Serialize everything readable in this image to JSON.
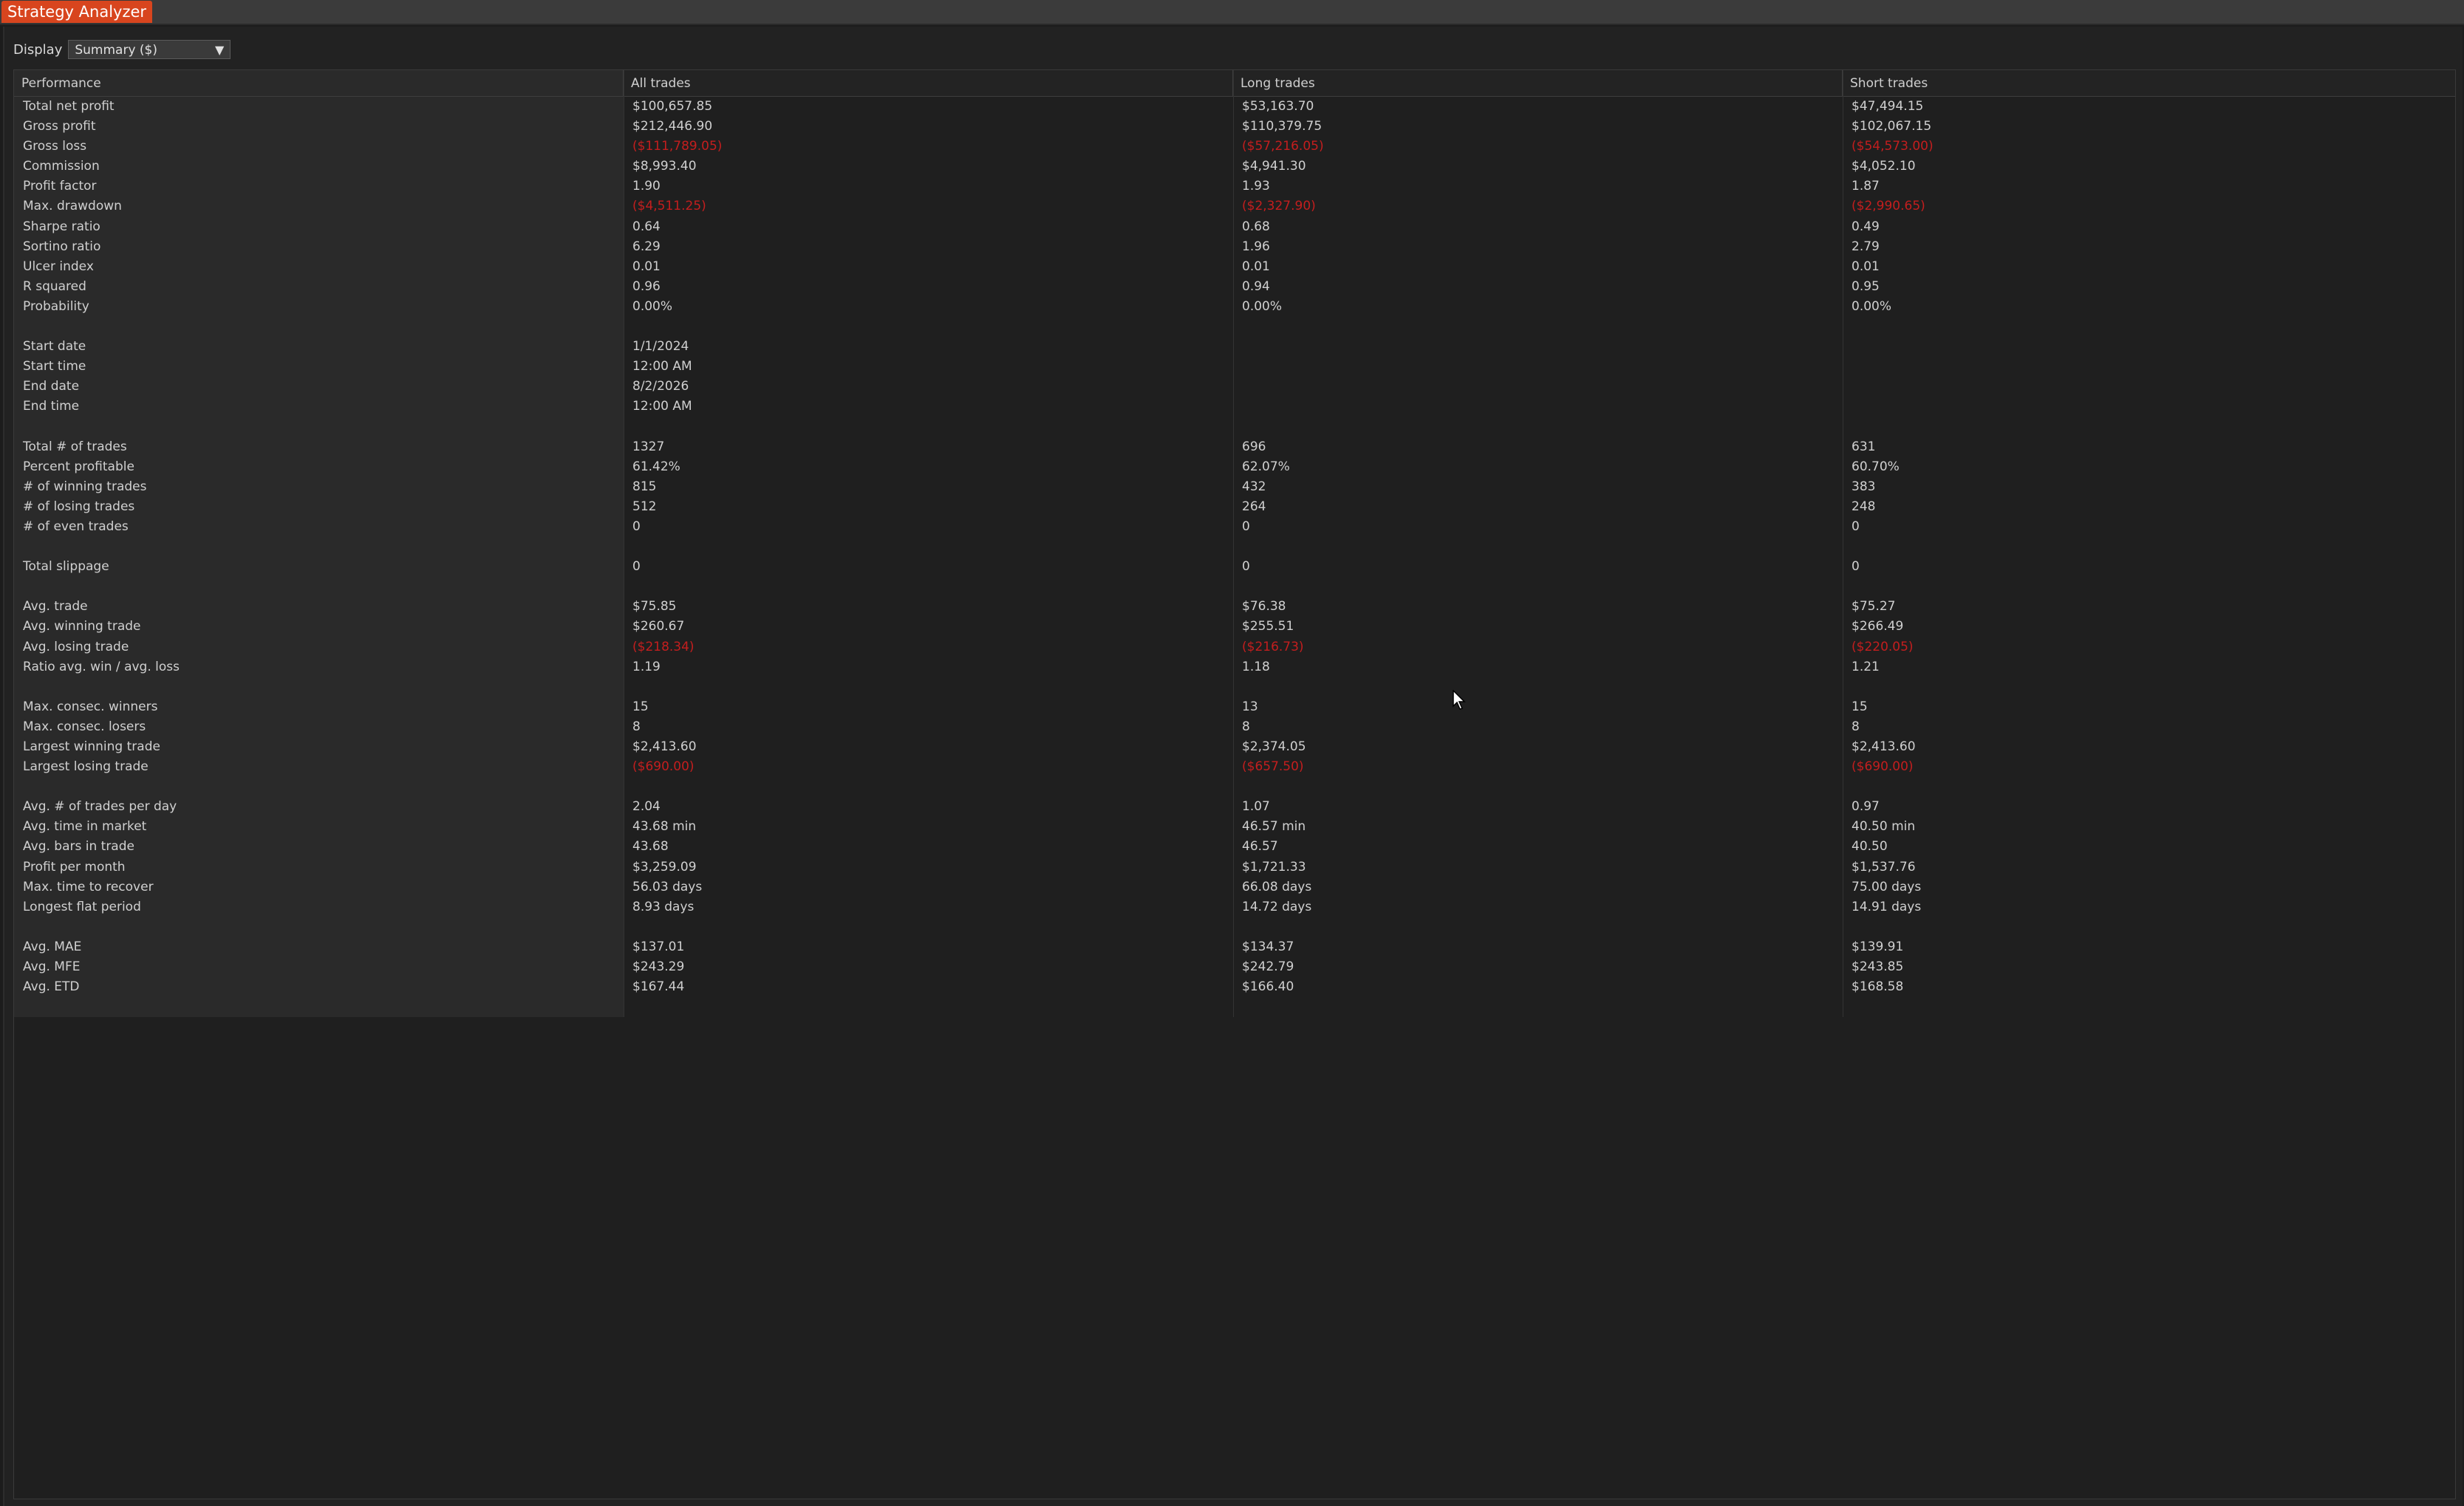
{
  "window": {
    "title": "Strategy Analyzer"
  },
  "display": {
    "label": "Display",
    "selected": "Summary ($)"
  },
  "columns": [
    "Performance",
    "All trades",
    "Long trades",
    "Short trades"
  ],
  "colors": {
    "accent": "#d8451e",
    "negative": "#c41e1e",
    "background": "#1c1c1c"
  },
  "rows": [
    {
      "label": "Total net profit",
      "all": "$100,657.85",
      "long": "$53,163.70",
      "short": "$47,494.15"
    },
    {
      "label": "Gross profit",
      "all": "$212,446.90",
      "long": "$110,379.75",
      "short": "$102,067.15"
    },
    {
      "label": "Gross loss",
      "all": "($111,789.05)",
      "long": "($57,216.05)",
      "short": "($54,573.00)",
      "neg": true
    },
    {
      "label": "Commission",
      "all": "$8,993.40",
      "long": "$4,941.30",
      "short": "$4,052.10"
    },
    {
      "label": "Profit factor",
      "all": "1.90",
      "long": "1.93",
      "short": "1.87"
    },
    {
      "label": "Max. drawdown",
      "all": "($4,511.25)",
      "long": "($2,327.90)",
      "short": "($2,990.65)",
      "neg": true
    },
    {
      "label": "Sharpe ratio",
      "all": "0.64",
      "long": "0.68",
      "short": "0.49"
    },
    {
      "label": "Sortino ratio",
      "all": "6.29",
      "long": "1.96",
      "short": "2.79"
    },
    {
      "label": "Ulcer index",
      "all": "0.01",
      "long": "0.01",
      "short": "0.01"
    },
    {
      "label": "R squared",
      "all": "0.96",
      "long": "0.94",
      "short": "0.95"
    },
    {
      "label": "Probability",
      "all": "0.00%",
      "long": "0.00%",
      "short": "0.00%"
    },
    {
      "label": "",
      "all": "",
      "long": "",
      "short": ""
    },
    {
      "label": "Start date",
      "all": "1/1/2024",
      "long": "",
      "short": ""
    },
    {
      "label": "Start time",
      "all": "12:00 AM",
      "long": "",
      "short": ""
    },
    {
      "label": "End date",
      "all": "8/2/2026",
      "long": "",
      "short": ""
    },
    {
      "label": "End time",
      "all": "12:00 AM",
      "long": "",
      "short": ""
    },
    {
      "label": "",
      "all": "",
      "long": "",
      "short": ""
    },
    {
      "label": "Total # of trades",
      "all": "1327",
      "long": "696",
      "short": "631"
    },
    {
      "label": "Percent profitable",
      "all": "61.42%",
      "long": "62.07%",
      "short": "60.70%"
    },
    {
      "label": "# of winning trades",
      "all": "815",
      "long": "432",
      "short": "383"
    },
    {
      "label": "# of losing trades",
      "all": "512",
      "long": "264",
      "short": "248"
    },
    {
      "label": "# of even trades",
      "all": "0",
      "long": "0",
      "short": "0"
    },
    {
      "label": "",
      "all": "",
      "long": "",
      "short": ""
    },
    {
      "label": "Total slippage",
      "all": "0",
      "long": "0",
      "short": "0"
    },
    {
      "label": "",
      "all": "",
      "long": "",
      "short": ""
    },
    {
      "label": "Avg. trade",
      "all": "$75.85",
      "long": "$76.38",
      "short": "$75.27"
    },
    {
      "label": "Avg. winning trade",
      "all": "$260.67",
      "long": "$255.51",
      "short": "$266.49"
    },
    {
      "label": "Avg. losing trade",
      "all": "($218.34)",
      "long": "($216.73)",
      "short": "($220.05)",
      "neg": true
    },
    {
      "label": "Ratio avg. win / avg. loss",
      "all": "1.19",
      "long": "1.18",
      "short": "1.21"
    },
    {
      "label": "",
      "all": "",
      "long": "",
      "short": ""
    },
    {
      "label": "Max. consec. winners",
      "all": "15",
      "long": "13",
      "short": "15"
    },
    {
      "label": "Max. consec. losers",
      "all": "8",
      "long": "8",
      "short": "8"
    },
    {
      "label": "Largest winning trade",
      "all": "$2,413.60",
      "long": "$2,374.05",
      "short": "$2,413.60"
    },
    {
      "label": "Largest losing trade",
      "all": "($690.00)",
      "long": "($657.50)",
      "short": "($690.00)",
      "neg": true
    },
    {
      "label": "",
      "all": "",
      "long": "",
      "short": ""
    },
    {
      "label": "Avg. # of trades per day",
      "all": "2.04",
      "long": "1.07",
      "short": "0.97"
    },
    {
      "label": "Avg. time in market",
      "all": "43.68 min",
      "long": "46.57 min",
      "short": "40.50 min"
    },
    {
      "label": "Avg. bars in trade",
      "all": "43.68",
      "long": "46.57",
      "short": "40.50"
    },
    {
      "label": "Profit per month",
      "all": "$3,259.09",
      "long": "$1,721.33",
      "short": "$1,537.76"
    },
    {
      "label": "Max. time to recover",
      "all": "56.03 days",
      "long": "66.08 days",
      "short": "75.00 days"
    },
    {
      "label": "Longest flat period",
      "all": "8.93 days",
      "long": "14.72 days",
      "short": "14.91 days"
    },
    {
      "label": "",
      "all": "",
      "long": "",
      "short": ""
    },
    {
      "label": "Avg. MAE",
      "all": "$137.01",
      "long": "$134.37",
      "short": "$139.91"
    },
    {
      "label": "Avg. MFE",
      "all": "$243.29",
      "long": "$242.79",
      "short": "$243.85"
    },
    {
      "label": "Avg. ETD",
      "all": "$167.44",
      "long": "$166.40",
      "short": "$168.58"
    }
  ]
}
